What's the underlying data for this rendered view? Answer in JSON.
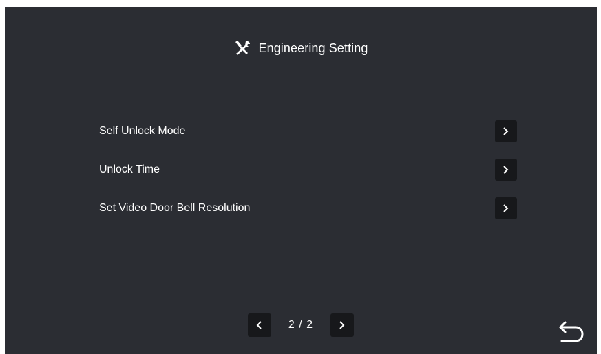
{
  "header": {
    "icon": "tools-icon",
    "title": "Engineering Setting"
  },
  "menu": {
    "items": [
      {
        "label": "Self Unlock Mode",
        "icon": "chevron-right-icon"
      },
      {
        "label": "Unlock Time",
        "icon": "chevron-right-icon"
      },
      {
        "label": "Set Video Door Bell Resolution",
        "icon": "chevron-right-icon"
      }
    ]
  },
  "pager": {
    "prev_icon": "chevron-left-icon",
    "page_text": "2 / 2",
    "next_icon": "chevron-right-icon"
  },
  "footer": {
    "back_icon": "back-arrow-icon"
  },
  "colors": {
    "background": "#2b2d33",
    "button": "#17181b",
    "text": "#ffffff"
  }
}
